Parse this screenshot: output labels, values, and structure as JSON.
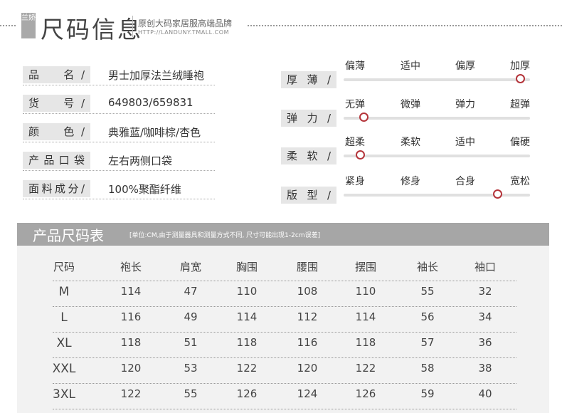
{
  "header": {
    "badge": "兰娇",
    "title": "尺码信息",
    "subtitle": "原创大码家居服高端品牌",
    "url": "HTTP://LANDUNY.TMALL.COM"
  },
  "info": [
    {
      "label": "品　名/",
      "value": "男士加厚法兰绒睡袍"
    },
    {
      "label": "货　号/",
      "value": "649803/659831"
    },
    {
      "label": "颜　色/",
      "value": "典雅蓝/咖啡棕/杏色"
    },
    {
      "label": "产品口袋",
      "value": "左右两侧口袋"
    },
    {
      "label": "面料成分/",
      "value": "100%聚酯纤维"
    }
  ],
  "sliders": [
    {
      "label": "厚薄/",
      "options": [
        "偏薄",
        "适中",
        "偏厚",
        "加厚"
      ],
      "level": 0.95
    },
    {
      "label": "弹力/",
      "options": [
        "无弹",
        "微弹",
        "弹力",
        "超弹"
      ],
      "level": 0.11
    },
    {
      "label": "柔软/",
      "options": [
        "超柔",
        "柔软",
        "适中",
        "偏硬"
      ],
      "level": 0.09
    },
    {
      "label": "版型/",
      "options": [
        "紧身",
        "修身",
        "合身",
        "宽松"
      ],
      "level": 0.83
    }
  ],
  "size_table": {
    "title": "产品尺码表",
    "note": "[单位:CM,由于测量器具和测量方式不同, 尺寸可能出现1-2cm误差]",
    "headers": [
      "尺码",
      "袍长",
      "肩宽",
      "胸围",
      "腰围",
      "摆围",
      "袖长",
      "袖口"
    ],
    "rows": [
      [
        "M",
        "114",
        "47",
        "110",
        "108",
        "110",
        "55",
        "32"
      ],
      [
        "L",
        "116",
        "49",
        "114",
        "112",
        "114",
        "56",
        "34"
      ],
      [
        "XL",
        "118",
        "51",
        "118",
        "116",
        "118",
        "57",
        "36"
      ],
      [
        "XXL",
        "120",
        "53",
        "122",
        "120",
        "122",
        "58",
        "38"
      ],
      [
        "3XL",
        "122",
        "55",
        "126",
        "124",
        "126",
        "59",
        "40"
      ]
    ]
  },
  "colors": {
    "knob": "#b4343a",
    "band": "#a6a6a6",
    "label_bg": "#e6e6e6"
  }
}
